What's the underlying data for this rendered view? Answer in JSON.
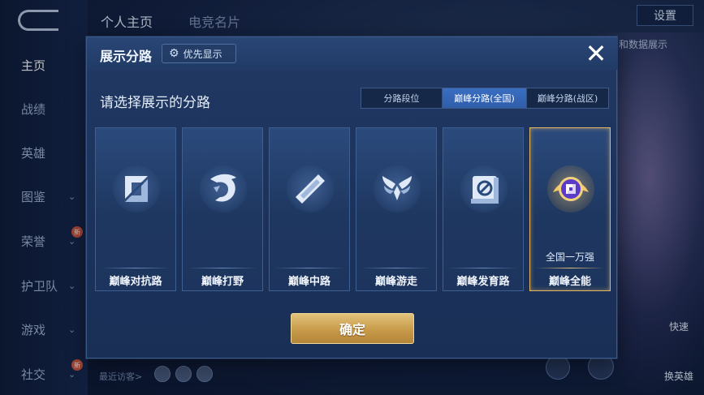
{
  "colors": {
    "accent_blue": "#2f5daa",
    "gold": "#c79b4a",
    "modal_bg": "#1c335c",
    "selected_border": "#e3b565"
  },
  "background": {
    "sidebar": {
      "items": [
        {
          "label": "主页",
          "active": true
        },
        {
          "label": "战绩"
        },
        {
          "label": "英雄"
        },
        {
          "label": "图鉴",
          "chevron": "⌄"
        },
        {
          "label": "荣誉",
          "chevron": "⌄",
          "badge": "新"
        },
        {
          "label": "护卫队",
          "chevron": "⌄"
        },
        {
          "label": "游戏",
          "chevron": "⌄"
        },
        {
          "label": "社交",
          "chevron": "⌄",
          "badge": "新"
        }
      ]
    },
    "top_tabs": [
      "个人主页",
      "电竞名片"
    ],
    "settings_label": "设置",
    "right_partial_text": "和数据展示",
    "recent_visitors_label": "最近访客>",
    "right_labels": [
      "快速",
      "换英雄"
    ]
  },
  "modal": {
    "title": "展示分路",
    "priority_button": {
      "icon": "gear-icon",
      "label": "优先显示"
    },
    "close_icon": "✕",
    "subtitle": "请选择展示的分路",
    "tabs": [
      {
        "label": "分路段位",
        "active": false
      },
      {
        "label": "巅峰分路(全国)",
        "active": true
      },
      {
        "label": "巅峰分路(战区)",
        "active": false
      }
    ],
    "cards": [
      {
        "name": "巅峰对抗路",
        "icon": "crossed-swords-icon",
        "selected": false
      },
      {
        "name": "巅峰打野",
        "icon": "dragon-icon",
        "selected": false
      },
      {
        "name": "巅峰中路",
        "icon": "staff-icon",
        "selected": false
      },
      {
        "name": "巅峰游走",
        "icon": "wings-icon",
        "selected": false
      },
      {
        "name": "巅峰发育路",
        "icon": "target-icon",
        "selected": false
      },
      {
        "name": "巅峰全能",
        "icon": "all-rounder-badge-icon",
        "selected": true,
        "extra": "全国一万强"
      }
    ],
    "confirm_label": "确定"
  }
}
